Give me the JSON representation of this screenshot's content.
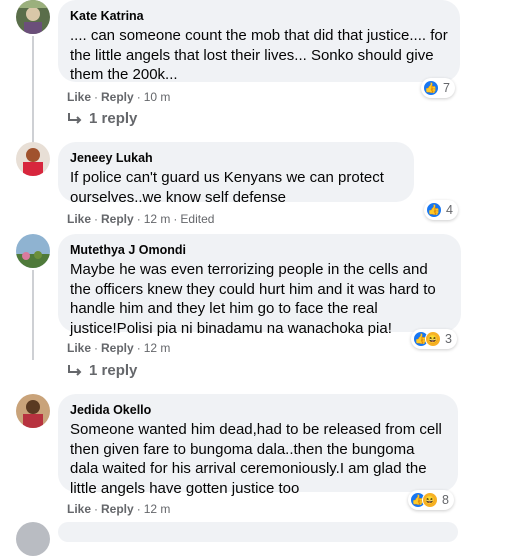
{
  "comments": [
    {
      "author": "Kate Katrina",
      "text": ".... can someone count the mob that did that justice.... for the little angels that lost their lives... Sonko should give them the 200k...",
      "like": "Like",
      "reply": "Reply",
      "time": "10 m",
      "edited": "",
      "reaction_count": "7",
      "replies": "1 reply"
    },
    {
      "author": "Jeneey Lukah",
      "text": "If police can't guard us Kenyans we can protect ourselves..we know self defense",
      "like": "Like",
      "reply": "Reply",
      "time": "12 m",
      "edited": "Edited",
      "reaction_count": "4",
      "replies": ""
    },
    {
      "author": "Mutethya J Omondi",
      "text": "Maybe he was even terrorizing people in the cells and the officers knew they could hurt him and it was hard to handle him and they let him go to face the real justice!Polisi pia ni binadamu na wanachoka pia!",
      "like": "Like",
      "reply": "Reply",
      "time": "12 m",
      "edited": "",
      "reaction_count": "3",
      "replies": "1 reply"
    },
    {
      "author": "Jedida Okello",
      "text": "Someone wanted him dead,had to be released from cell then given fare to bungoma dala..then the bungoma dala waited for his arrival ceremoniously.I am glad the little angels have gotten justice too",
      "like": "Like",
      "reply": "Reply",
      "time": "12 m",
      "edited": "",
      "reaction_count": "8",
      "replies": ""
    }
  ],
  "colors": {
    "bubble": "#f0f2f5",
    "meta": "#65676b",
    "like_blue": "#1877f2",
    "haha_yellow": "#f7b125"
  },
  "icons": [
    "like-reaction-icon",
    "haha-reaction-icon",
    "reply-arrow-icon"
  ]
}
